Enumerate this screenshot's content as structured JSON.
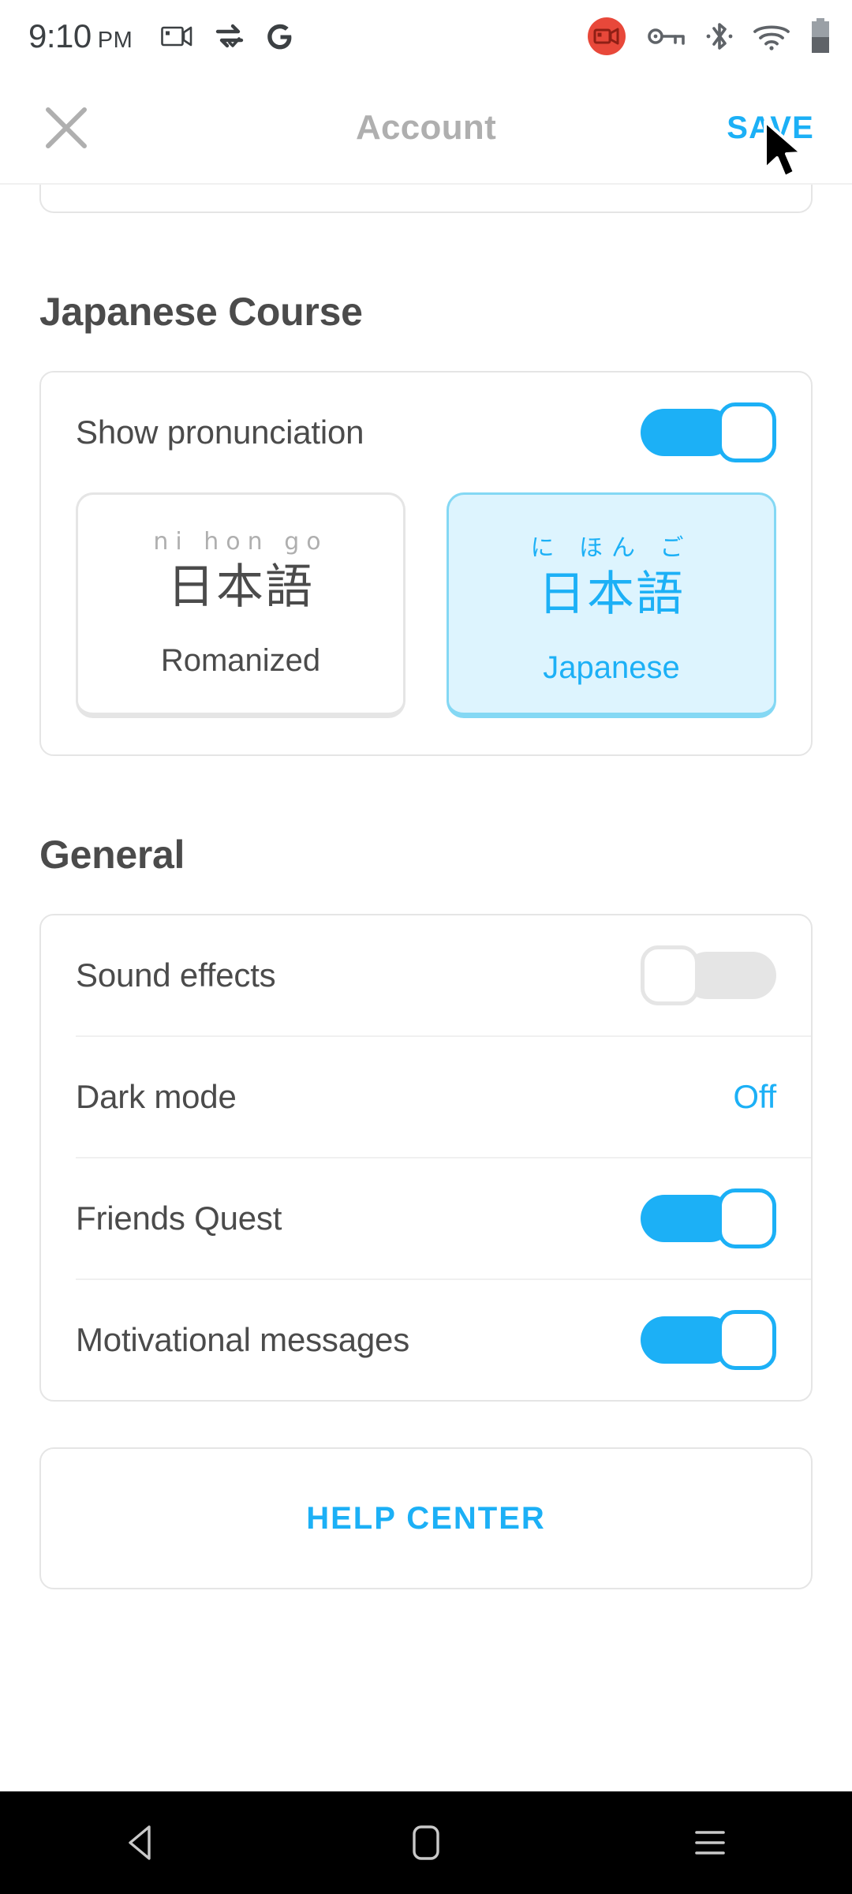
{
  "status_bar": {
    "time": "9:10",
    "am_pm": "PM",
    "left_icons": [
      "screen-record-icon",
      "data-sync-icon",
      "google-g-icon"
    ],
    "right_icons": [
      "screen-recording-active-icon",
      "vpn-key-icon",
      "bluetooth-icon",
      "wifi-icon",
      "battery-icon"
    ],
    "recording_color": "#e8483a"
  },
  "header": {
    "close_icon": "close-icon",
    "title": "Account",
    "save_label": "SAVE",
    "accent": "#1cb0f6",
    "title_color": "#afafaf"
  },
  "sections": [
    {
      "title": "Japanese Course",
      "pronunciation": {
        "label": "Show pronunciation",
        "enabled": true,
        "choices": [
          {
            "ruby": "ni hon go",
            "kanji": "日本語",
            "label": "Romanized",
            "selected": false
          },
          {
            "ruby": "に ほん ご",
            "kanji": "日本語",
            "label": "Japanese",
            "selected": true
          }
        ]
      }
    },
    {
      "title": "General",
      "rows": [
        {
          "label": "Sound effects",
          "control": "toggle",
          "enabled": false
        },
        {
          "label": "Dark mode",
          "control": "value",
          "value": "Off"
        },
        {
          "label": "Friends Quest",
          "control": "toggle",
          "enabled": true
        },
        {
          "label": "Motivational messages",
          "control": "toggle",
          "enabled": true
        }
      ]
    }
  ],
  "help": {
    "label": "HELP CENTER"
  },
  "nav_bar": {
    "back": "back-nav-icon",
    "home": "home-nav-icon",
    "recents": "recents-nav-icon"
  },
  "colors": {
    "accent_blue": "#1cb0f6",
    "selected_fill": "#ddf4fe",
    "selected_border": "#84d8f4",
    "text_dark": "#4b4b4b",
    "border_gray": "#e5e5e5"
  }
}
